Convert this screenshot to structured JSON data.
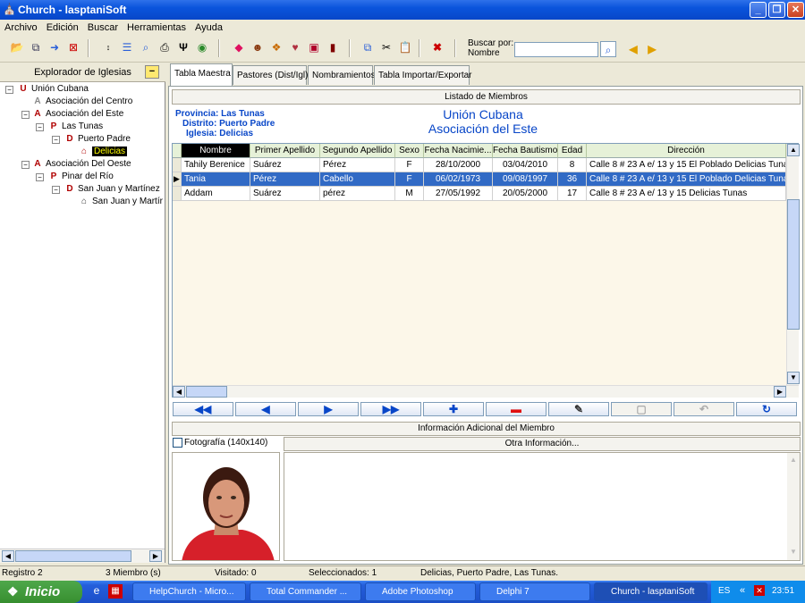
{
  "window": {
    "title": "Church - lasptaniSoft"
  },
  "menu": [
    "Archivo",
    "Edición",
    "Buscar",
    "Herramientas",
    "Ayuda"
  ],
  "search": {
    "label": "Buscar por:",
    "sublabel": "Nombre",
    "value": ""
  },
  "explorer": {
    "title": "Explorador de Iglesias"
  },
  "tree": [
    {
      "label": "Unión Cubana",
      "icon": "U"
    },
    {
      "label": "Asociación del Centro",
      "icon": "A"
    },
    {
      "label": "Asociación del Este",
      "icon": "A"
    },
    {
      "label": "Las Tunas",
      "icon": "P"
    },
    {
      "label": "Puerto Padre",
      "icon": "D"
    },
    {
      "label": "Delicias",
      "icon": "church"
    },
    {
      "label": "Asociación Del Oeste",
      "icon": "A"
    },
    {
      "label": "Pinar del Río",
      "icon": "P"
    },
    {
      "label": "San Juan y Martínez",
      "icon": "D"
    },
    {
      "label": "San Juan y Martír",
      "icon": "church"
    }
  ],
  "tabs": [
    "Tabla Maestra",
    "Pastores (Dist/Igl)",
    "Nombramientos",
    "Tabla Importar/Exportar"
  ],
  "listing": {
    "header": "Listado de Miembros",
    "province": "Provincia: Las Tunas",
    "district": "Distrito: Puerto Padre",
    "church": "Iglesia: Delicias",
    "union": "Unión Cubana",
    "association": "Asociación del Este"
  },
  "table": {
    "columns": [
      "Nombre",
      "Primer Apellido",
      "Segundo Apellido",
      "Sexo",
      "Fecha Nacimie...",
      "Fecha Bautismo",
      "Edad",
      "Dirección"
    ],
    "rows": [
      [
        "Tahily Berenice",
        "Suárez",
        "Pérez",
        "F",
        "28/10/2000",
        "03/04/2010",
        "8",
        "Calle 8 # 23 A e/ 13 y 15 El Poblado Delicias Tuna"
      ],
      [
        "Tania",
        "Pérez",
        "Cabello",
        "F",
        "06/02/1973",
        "09/08/1997",
        "36",
        "Calle 8 # 23 A e/ 13 y 15 El Poblado Delicias Tuna"
      ],
      [
        "Addam",
        "Suárez",
        "pérez",
        "M",
        "27/05/1992",
        "20/05/2000",
        "17",
        "Calle 8 # 23 A e/ 13 y 15 Delicias Tunas"
      ]
    ]
  },
  "extra": {
    "header": "Información Adicional del Miembro",
    "photo_label": "Fotografía (140x140)",
    "other_label": "Otra Información..."
  },
  "status": {
    "record": "Registro 2",
    "members": "3 Miembro (s)",
    "visited": "Visitado: 0",
    "selected": "Seleccionados: 1",
    "location": "Delicias, Puerto Padre, Las Tunas."
  },
  "taskbar": {
    "start": "Inicio",
    "tasks": [
      "HelpChurch - Micro...",
      "Total Commander ...",
      "Adobe Photoshop",
      "Delphi 7",
      "Church - lasptaniSoft"
    ],
    "lang": "ES",
    "clock": "23:51"
  },
  "colors": {
    "accent": "#0846c8",
    "selection": "#316ac5",
    "grid_bg": "#fcf7e9",
    "delete": "#e01010"
  }
}
